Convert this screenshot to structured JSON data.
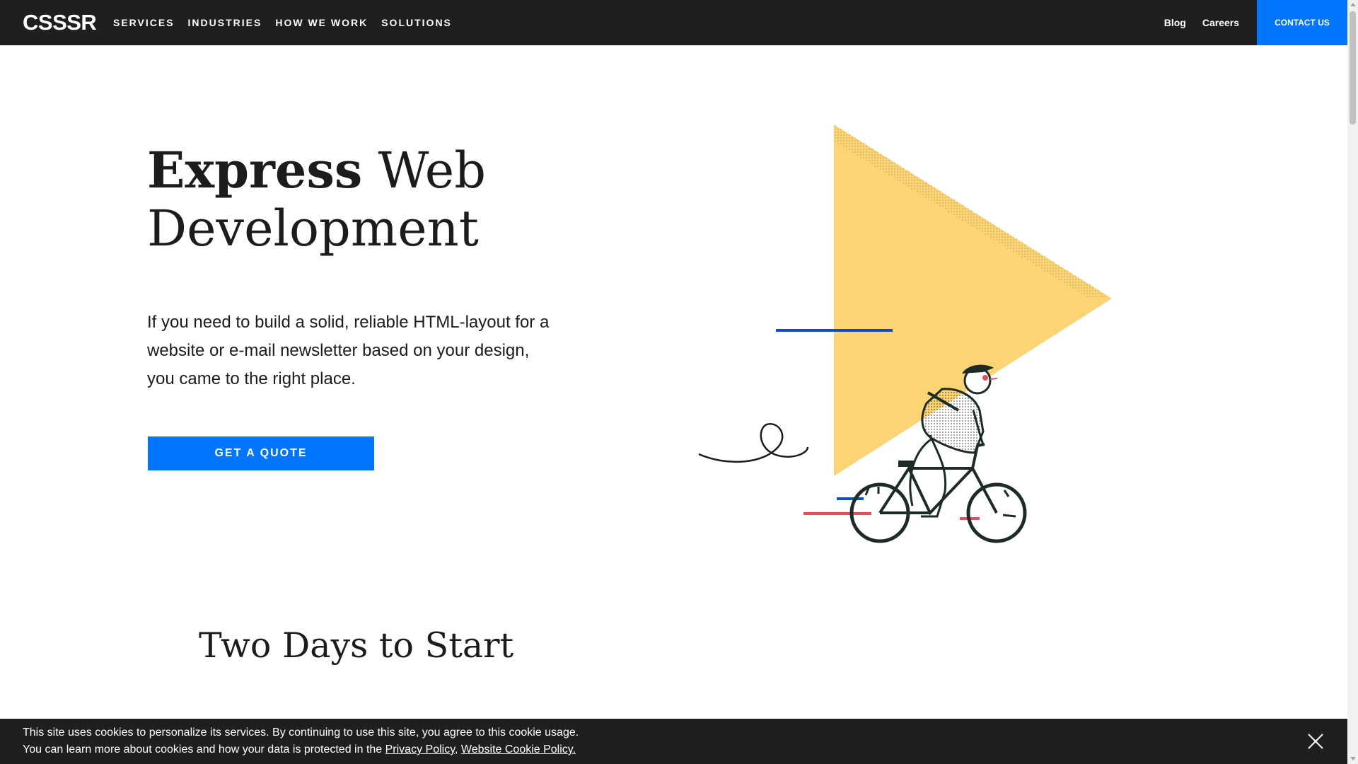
{
  "header": {
    "logo": "CSSSR",
    "nav": [
      "SERVICES",
      "INDUSTRIES",
      "HOW WE WORK",
      "SOLUTIONS"
    ],
    "blog": "Blog",
    "careers": "Careers",
    "contact": "CONTACT US"
  },
  "hero": {
    "title_bold": "Express",
    "title_light_1": "Web",
    "title_light_2": "Development",
    "description": "If you need to build a solid, reliable HTML-layout for a website or e-mail newsletter based on your design, you came to the right place.",
    "cta": "GET A QUOTE"
  },
  "section": {
    "title": "Two Days to Start"
  },
  "cookie": {
    "line1": "This site uses cookies to personalize its services. By continuing to use this site, you agree to this cookie usage.",
    "line2_prefix": "You can learn more about cookies and how your data is protected in the ",
    "privacy_link": "Privacy Policy",
    "separator": ", ",
    "cookie_link": "Website Cookie Policy."
  },
  "colors": {
    "header_bg": "#1f1f1f",
    "accent_blue": "#0076ff",
    "triangle_yellow": "#fdd474",
    "line_blue": "#0b4fc4",
    "line_red": "#e0505a"
  },
  "icons": {
    "close": "close-icon",
    "illustration": "cyclist-triangle-illustration"
  }
}
